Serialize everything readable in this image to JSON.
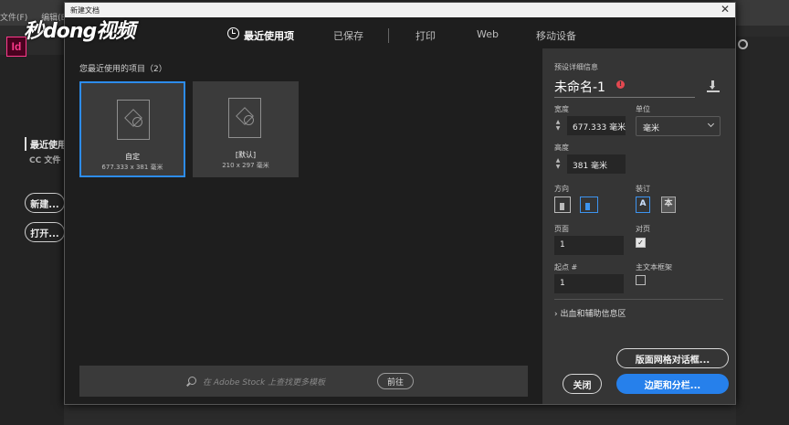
{
  "app": {
    "menu": [
      "文件(F)",
      "编辑(E)"
    ],
    "logo": "Id",
    "recent_label": "最近使用",
    "cc_label": "CC 文件",
    "new_button": "新建...",
    "open_button": "打开..."
  },
  "watermark": {
    "text_a": "秒",
    "text_b": "d",
    "text_o": "o",
    "text_c": "ng视频"
  },
  "dialog": {
    "title": "新建文档",
    "close": "✕",
    "tabs": [
      "最近使用项",
      "已保存",
      "打印",
      "Web",
      "移动设备"
    ],
    "recent_title": "您最近使用的项目（2）",
    "presets": [
      {
        "name": "自定",
        "dims": "677.333 x 381 毫米"
      },
      {
        "name": "[默认]",
        "dims": "210 x 297 毫米"
      }
    ],
    "stock": {
      "placeholder": "在 Adobe Stock 上查找更多模板",
      "go": "前往"
    },
    "details": {
      "section_title": "预设详细信息",
      "doc_name": "未命名-1",
      "width_label": "宽度",
      "width_value": "677.333 毫米",
      "unit_label": "单位",
      "unit_value": "毫米",
      "height_label": "高度",
      "height_value": "381 毫米",
      "orientation_label": "方向",
      "binding_label": "装订",
      "binding_left": "A",
      "binding_right": "本",
      "pages_label": "页面",
      "pages_value": "1",
      "facing_label": "对页",
      "facing_checked": true,
      "start_label": "起点 #",
      "start_value": "1",
      "primary_frame_label": "主文本框架",
      "bleed_label": "出血和辅助信息区",
      "grid_button": "版面网格对话框...",
      "close_button": "关闭",
      "margins_button": "边距和分栏..."
    }
  },
  "colors": {
    "accent": "#2680eb",
    "dialog_bg": "#1e1e1e",
    "panel_bg": "#353535"
  }
}
